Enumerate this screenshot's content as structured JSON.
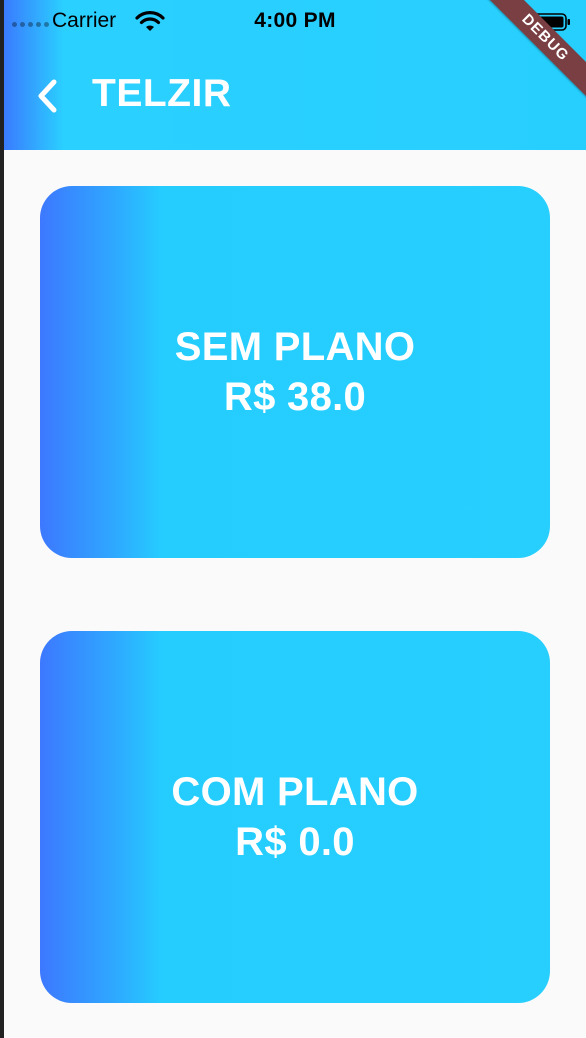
{
  "status_bar": {
    "carrier": "Carrier",
    "time": "4:00 PM"
  },
  "debug_banner": "DEBUG",
  "app_bar": {
    "title": "TELZIR",
    "back_icon": "chevron-left-icon"
  },
  "plans": [
    {
      "name": "SEM PLANO",
      "price": "R$ 38.0"
    },
    {
      "name": "COM PLANO",
      "price": "R$ 0.0"
    }
  ],
  "colors": {
    "gradient_start": "#3d78ff",
    "gradient_end": "#27cfff",
    "background": "#fafafa",
    "text": "#ffffff",
    "debug_ribbon": "#7a3f43"
  }
}
